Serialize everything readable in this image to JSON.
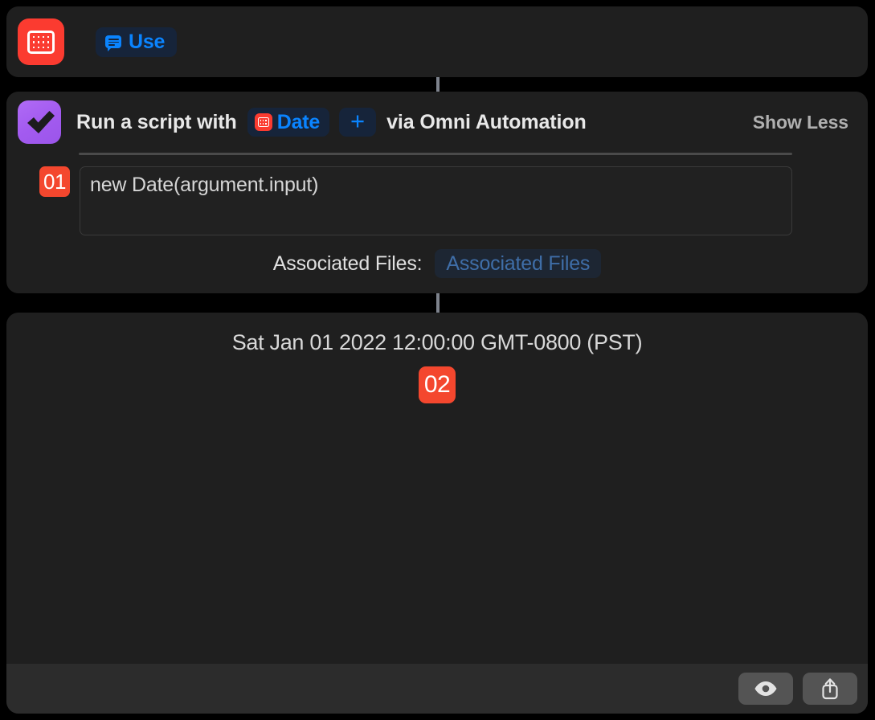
{
  "source_card": {
    "app_icon": "calendar-app-icon",
    "action_pill": {
      "icon": "speech-bubble-icon",
      "label": "Use"
    }
  },
  "action_card": {
    "app_icon": "omnifocus-checkmark-icon",
    "title_lead": "Run a script with",
    "variable_token": {
      "icon": "calendar-app-icon",
      "label": "Date"
    },
    "add_token_label": "+",
    "title_tail": "via Omni Automation",
    "disclosure_label": "Show Less",
    "script": {
      "line_number": "01",
      "code": "new Date(argument.input)"
    },
    "associated_files": {
      "label": "Associated Files:",
      "value": "Associated Files"
    }
  },
  "result_card": {
    "result_text": "Sat Jan 01 2022 12:00:00 GMT-0800 (PST)",
    "step_badge": "02",
    "toolbar": {
      "preview_icon": "eye-icon",
      "share_icon": "share-icon"
    }
  },
  "colors": {
    "background": "#000000",
    "card": "#1f1f1f",
    "accent_blue": "#0a84ff",
    "accent_red": "#fb3b30",
    "accent_purple": "#a35bf0",
    "chip_red": "#f4472e",
    "connector": "#7d828c",
    "toolbar": "#2c2c2c"
  }
}
